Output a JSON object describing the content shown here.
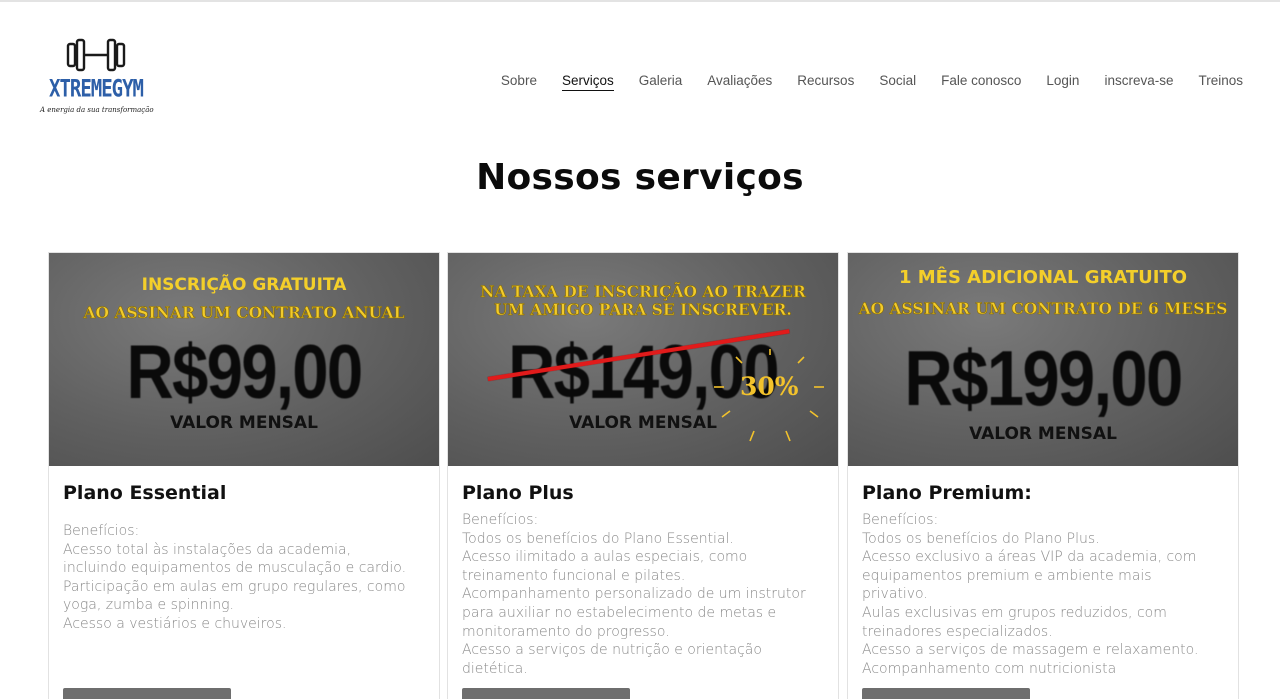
{
  "brand": {
    "name": "XTREMEGYM",
    "tagline": "A energia da sua transformação"
  },
  "nav": [
    {
      "label": "Sobre",
      "active": false
    },
    {
      "label": "Serviços",
      "active": true
    },
    {
      "label": "Galeria",
      "active": false
    },
    {
      "label": "Avaliações",
      "active": false
    },
    {
      "label": "Recursos",
      "active": false
    },
    {
      "label": "Social",
      "active": false
    },
    {
      "label": "Fale conosco",
      "active": false
    },
    {
      "label": "Login",
      "active": false
    },
    {
      "label": "inscreva-se",
      "active": false
    },
    {
      "label": "Treinos",
      "active": false
    }
  ],
  "page": {
    "title": "Nossos serviços"
  },
  "plans": [
    {
      "banner": {
        "promo_line1": "INSCRIÇÃO GRATUITA",
        "promo_line2": "AO ASSINAR UM CONTRATO ANUAL",
        "price": "R$99,00",
        "price_caption": "VALOR MENSAL"
      },
      "title": "Plano Essential",
      "benefits_heading": "Benefícios:",
      "benefits": [
        "Acesso total às instalações da academia,",
        "incluindo equipamentos de musculação e cardio.",
        "Participação em aulas em grupo regulares, como",
        "yoga, zumba e spinning.",
        "Acesso a vestiários e chuveiros."
      ]
    },
    {
      "banner": {
        "promo_line1": "NA TAXA DE INSCRIÇÃO AO TRAZER",
        "promo_line2": "UM AMIGO PARA SE INSCREVER.",
        "price": "R$149,00",
        "discount": "30%",
        "price_caption": "VALOR MENSAL"
      },
      "title": "Plano Plus",
      "benefits_heading": "Benefícios:",
      "benefits": [
        "Todos os benefícios do Plano Essential.",
        "Acesso ilimitado a aulas especiais, como",
        "treinamento funcional e pilates.",
        "Acompanhamento personalizado de um instrutor",
        "para auxiliar no estabelecimento de metas e",
        "monitoramento do progresso.",
        "Acesso a serviços de nutrição e orientação",
        "dietética."
      ]
    },
    {
      "banner": {
        "promo_line1": "1 MÊS ADICIONAL GRATUITO",
        "promo_line2": "AO ASSINAR UM CONTRATO DE 6 MESES",
        "price": "R$199,00",
        "price_caption": "VALOR MENSAL"
      },
      "title": "Plano Premium:",
      "benefits_heading": "Benefícios:",
      "benefits": [
        "Todos os benefícios do Plano Plus.",
        "Acesso exclusivo a áreas VIP da academia, com",
        "equipamentos premium e ambiente mais",
        "privativo.",
        "Aulas exclusivas em grupos reduzidos, com",
        "treinadores especializados.",
        "Acesso a serviços de massagem e relaxamento.",
        "Acompanhamento com nutricionista"
      ]
    }
  ],
  "colors": {
    "brand_blue": "#2d5fa8",
    "promo_yellow": "#f4cf2a",
    "strike_red": "#e11b1b",
    "button_gray": "#6e6e6e"
  }
}
